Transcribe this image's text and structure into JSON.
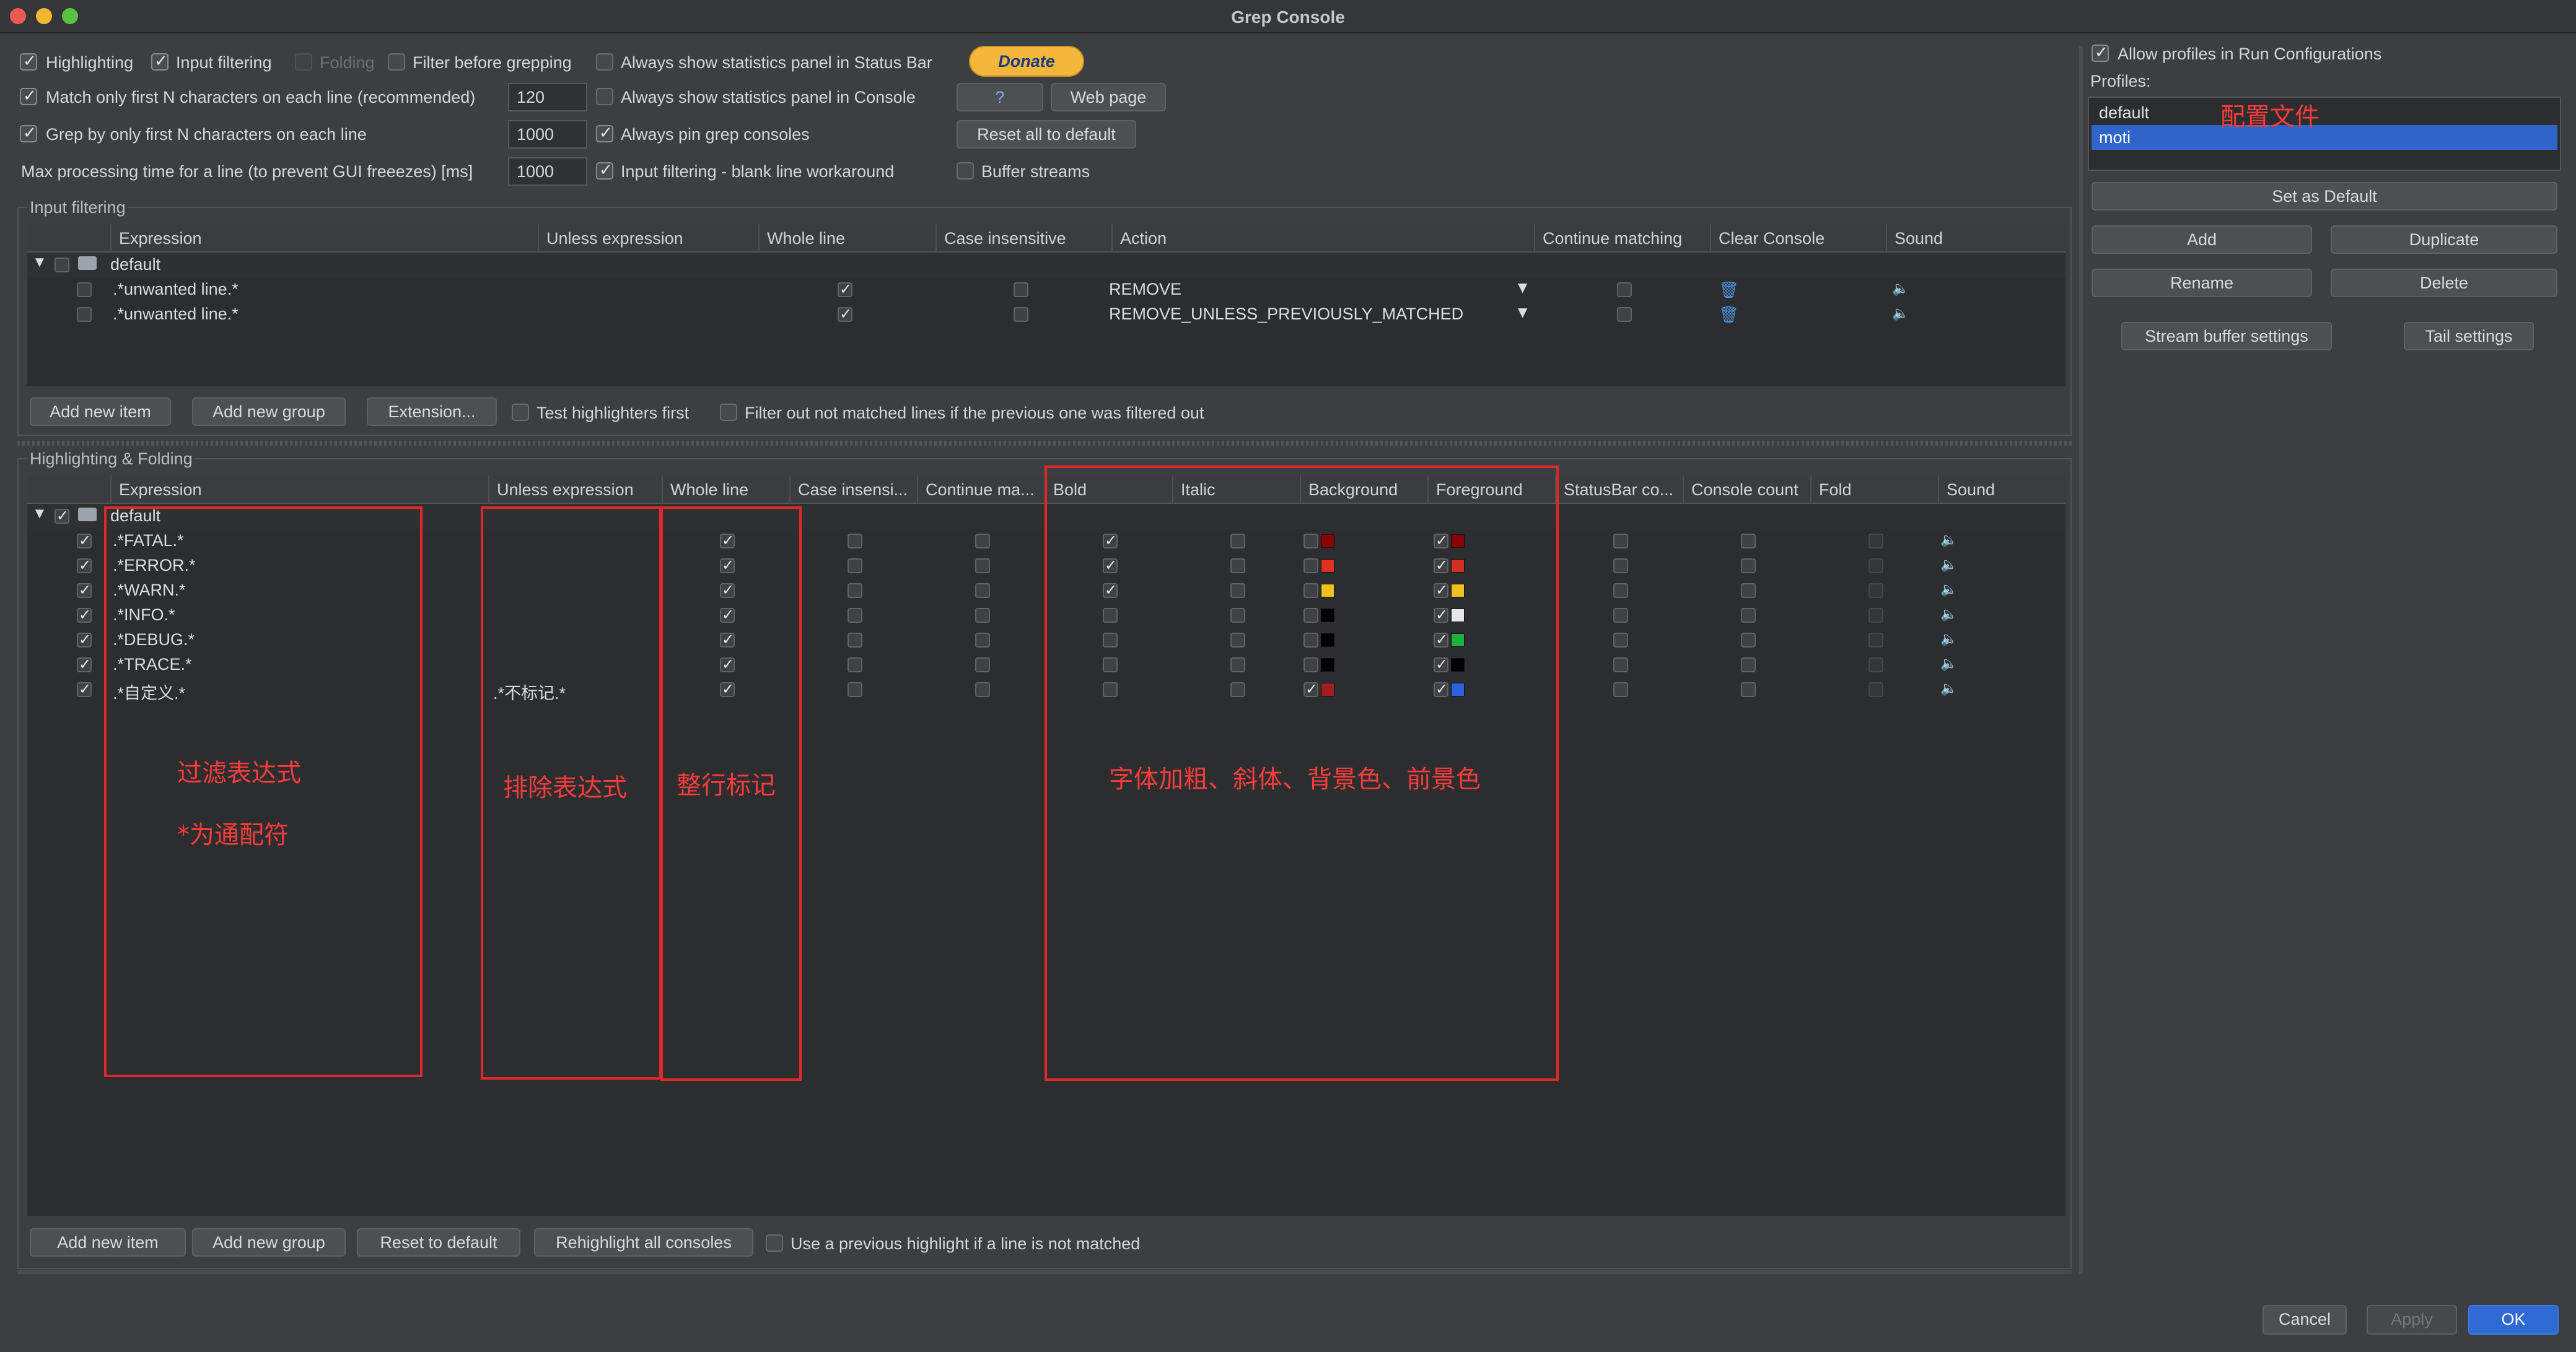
{
  "window": {
    "title": "Grep Console"
  },
  "options": {
    "highlighting": {
      "label": "Highlighting",
      "checked": true
    },
    "input_filtering": {
      "label": "Input filtering",
      "checked": true
    },
    "folding": {
      "label": "Folding",
      "checked": false
    },
    "filter_before_grepping": {
      "label": "Filter before grepping",
      "checked": false
    },
    "always_show_stats_status_bar": {
      "label": "Always show statistics panel in Status Bar",
      "checked": false
    },
    "match_first_n": {
      "label": "Match only first N characters on each line (recommended)",
      "checked": true,
      "value": "120"
    },
    "always_show_stats_console": {
      "label": "Always show statistics panel in Console",
      "checked": false
    },
    "grep_first_n": {
      "label": "Grep by only first N characters on each line",
      "checked": true,
      "value": "1000"
    },
    "always_pin": {
      "label": "Always pin grep consoles",
      "checked": true
    },
    "max_processing": {
      "label": "Max processing time for a line (to prevent GUI freeezes) [ms]",
      "value": "1000"
    },
    "blank_line_workaround": {
      "label": "Input filtering - blank line workaround",
      "checked": true
    },
    "buffer_streams": {
      "label": "Buffer streams",
      "checked": false
    }
  },
  "buttons": {
    "donate": "Donate",
    "help": "?",
    "web_page": "Web page",
    "reset_all": "Reset all to default"
  },
  "input_filtering": {
    "section_title": "Input filtering",
    "columns": [
      "Expression",
      "Unless expression",
      "Whole line",
      "Case insensitive",
      "Action",
      "Continue matching",
      "Clear Console",
      "Sound"
    ],
    "group": "default",
    "rows": [
      {
        "expression": ".*unwanted line.*",
        "whole_line": true,
        "case_insensitive": false,
        "action": "REMOVE",
        "continue_matching": false
      },
      {
        "expression": ".*unwanted line.*",
        "whole_line": true,
        "case_insensitive": false,
        "action": "REMOVE_UNLESS_PREVIOUSLY_MATCHED",
        "continue_matching": false
      }
    ],
    "buttons": {
      "add_item": "Add new item",
      "add_group": "Add new group",
      "extension": "Extension..."
    },
    "test_highlighters_first": {
      "label": "Test highlighters first",
      "checked": false
    },
    "filter_out_not_matched": {
      "label": "Filter out not matched lines if the previous one was filtered out",
      "checked": false
    }
  },
  "highlighting": {
    "section_title": "Highlighting & Folding",
    "columns": [
      "Expression",
      "Unless expression",
      "Whole line",
      "Case insensi...",
      "Continue ma...",
      "Bold",
      "Italic",
      "Background",
      "Foreground",
      "StatusBar co...",
      "Console count",
      "Fold",
      "Sound"
    ],
    "group": "default",
    "rows": [
      {
        "expression": ".*FATAL.*",
        "unless": "",
        "bold": true,
        "bg_on": false,
        "bg": "#8b0000",
        "fg_on": true,
        "fg": "#8b0000"
      },
      {
        "expression": ".*ERROR.*",
        "unless": "",
        "bold": true,
        "bg_on": false,
        "bg": "#e03020",
        "fg_on": true,
        "fg": "#d03020"
      },
      {
        "expression": ".*WARN.*",
        "unless": "",
        "bold": true,
        "bg_on": false,
        "bg": "#f0c020",
        "fg_on": true,
        "fg": "#f0c020"
      },
      {
        "expression": ".*INFO.*",
        "unless": "",
        "bold": false,
        "bg_on": false,
        "bg": "#000000",
        "fg_on": true,
        "fg": "#e8e8e8"
      },
      {
        "expression": ".*DEBUG.*",
        "unless": "",
        "bold": false,
        "bg_on": false,
        "bg": "#000000",
        "fg_on": true,
        "fg": "#20b040"
      },
      {
        "expression": ".*TRACE.*",
        "unless": "",
        "bold": false,
        "bg_on": false,
        "bg": "#000000",
        "fg_on": true,
        "fg": "#000000"
      },
      {
        "expression": ".*自定义.*",
        "unless": ".*不标记.*",
        "bold": false,
        "bg_on": true,
        "bg": "#a02020",
        "fg_on": true,
        "fg": "#3060e0"
      }
    ],
    "buttons": {
      "add_item": "Add new item",
      "add_group": "Add new group",
      "reset": "Reset to default",
      "rehighlight": "Rehighlight all consoles"
    },
    "use_previous": {
      "label": "Use a previous highlight if a line is not matched",
      "checked": false
    }
  },
  "annotations": {
    "filter_expr": "过滤表达式",
    "wildcard": "*为通配符",
    "exclude_expr": "排除表达式",
    "whole_line": "整行标记",
    "font_style": "字体加粗、斜体、背景色、前景色",
    "profiles": "配置文件"
  },
  "profiles": {
    "allow_in_run_configs": {
      "label": "Allow profiles in Run Configurations",
      "checked": true
    },
    "label": "Profiles:",
    "items": [
      "default",
      "moti"
    ],
    "selected": "moti",
    "buttons": {
      "set_default": "Set as Default",
      "add": "Add",
      "duplicate": "Duplicate",
      "rename": "Rename",
      "delete": "Delete",
      "stream_buffer": "Stream buffer settings",
      "tail": "Tail settings"
    }
  },
  "footer": {
    "cancel": "Cancel",
    "apply": "Apply",
    "ok": "OK"
  },
  "colors": {
    "accent": "#2f65ca",
    "annotation": "#e02828",
    "ok_button": "#2f6ad4"
  }
}
